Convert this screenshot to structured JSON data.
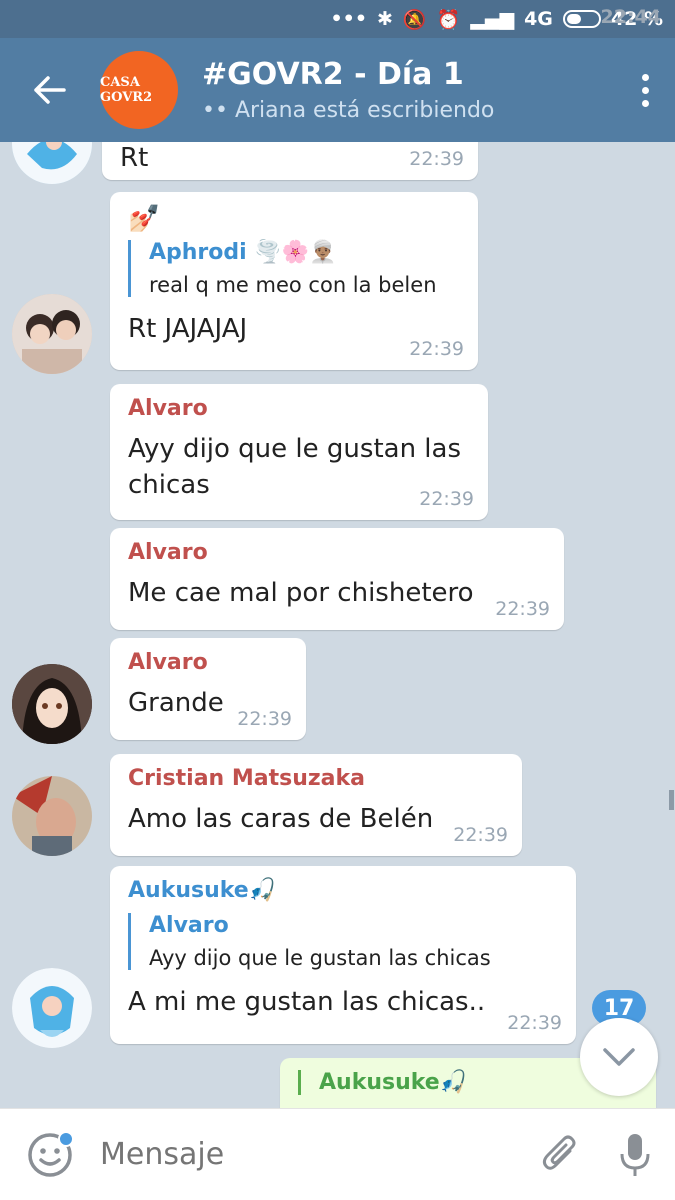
{
  "status_bar": {
    "time": "22:44",
    "network": "4G",
    "battery": "42 %"
  },
  "header": {
    "avatar_text": "CASA GOVR2",
    "title": "#GOVR2 - Día 1",
    "subtitle": "•• Ariana está escribiendo"
  },
  "messages": [
    {
      "text": "Rt",
      "time": "22:39"
    },
    {
      "emoji": "💅🏻",
      "reply_name": "Aphrodi 🌪️🌸👳🏽‍♂️",
      "reply_text": "real q me meo con la belen",
      "text": "Rt JAJAJAJ",
      "time": "22:39"
    },
    {
      "sender": "Alvaro",
      "text_line1": "Ayy dijo que le gustan las",
      "text_line2": "chicas",
      "time": "22:39"
    },
    {
      "sender": "Alvaro",
      "text": "Me cae mal por chishetero",
      "time": "22:39"
    },
    {
      "sender": "Alvaro",
      "text": "Grande",
      "time": "22:39"
    },
    {
      "sender": "Cristian Matsuzaka",
      "text": "Amo las caras de Belén",
      "time": "22:39"
    },
    {
      "sender": "Aukusuke🎣",
      "reply_name": "Alvaro",
      "reply_text": "Ayy dijo que le gustan las chicas",
      "text": "A mi me gustan las chicas..",
      "time": "22:39"
    },
    {
      "reply_name": "Aukusuke🎣"
    }
  ],
  "colors": {
    "alvaro": "#c0504d",
    "cristian": "#c0504d",
    "aukusuke": "#3d8fd0"
  },
  "unread_badge": "17",
  "composer": {
    "placeholder": "Mensaje"
  }
}
